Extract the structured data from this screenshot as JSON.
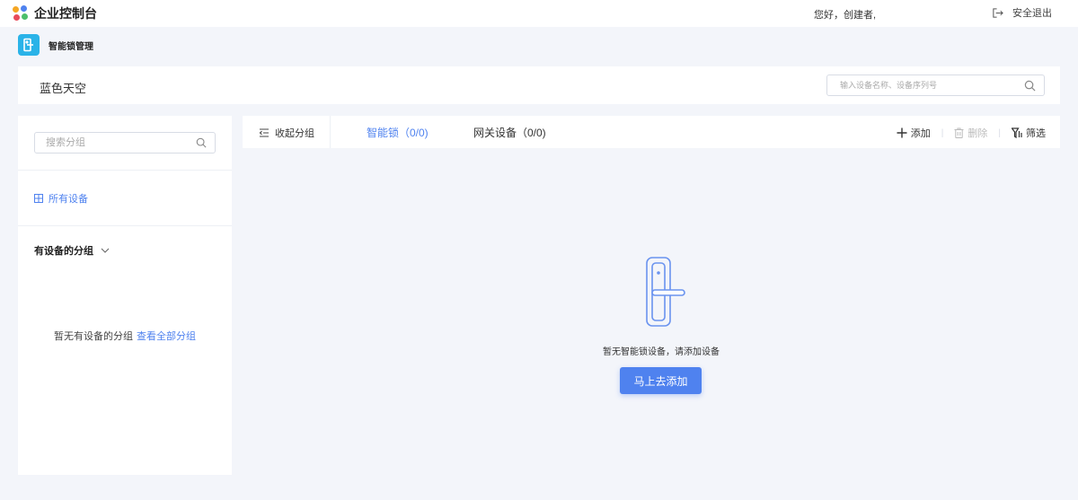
{
  "topbar": {
    "title": "企业控制台",
    "greeting": "您好，创建者,",
    "logout_label": "安全退出"
  },
  "app": {
    "title": "智能锁管理"
  },
  "org": {
    "name": "蓝色天空",
    "search_placeholder": "输入设备名称、设备序列号"
  },
  "sidebar": {
    "search_placeholder": "搜索分组",
    "all_devices_label": "所有设备",
    "group_header": "有设备的分组",
    "empty_text": "暂无有设备的分组",
    "view_all_link": "查看全部分组"
  },
  "tabs": {
    "collapse_label": "收起分组",
    "items": [
      {
        "label": "智能锁（0/0)"
      },
      {
        "label": "网关设备（0/0)"
      }
    ]
  },
  "actions": {
    "add_label": "添加",
    "delete_label": "删除",
    "filter_label": "筛选"
  },
  "empty_state": {
    "message": "暂无智能锁设备，请添加设备",
    "button_label": "马上去添加"
  },
  "colors": {
    "accent": "#4f82ef",
    "app_icon": "#2ab3e8",
    "background": "#f3f5fa"
  }
}
